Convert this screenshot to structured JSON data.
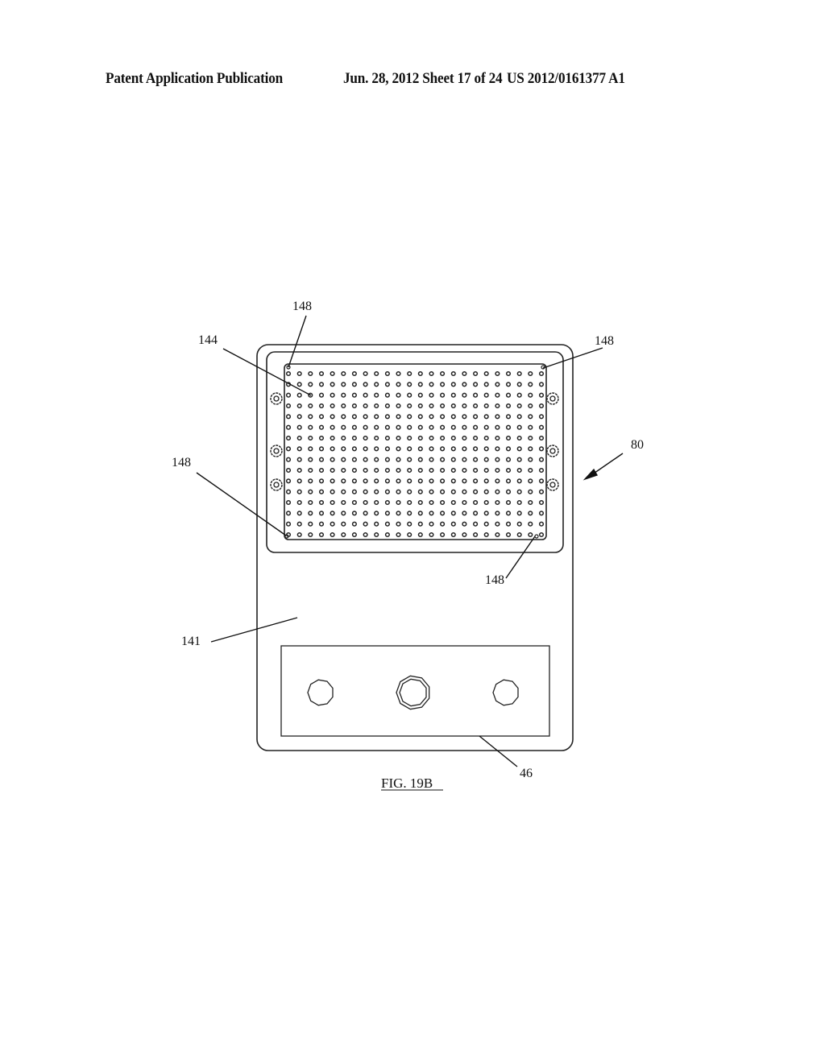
{
  "header": {
    "publication_type": "Patent Application Publication",
    "date_sheet": "Jun. 28, 2012  Sheet 17 of 24",
    "publication_number": "US 2012/0161377 A1"
  },
  "figure": {
    "caption": "FIG. 19B",
    "grid": {
      "columns": 24,
      "rows": 16
    },
    "side_fasteners_per_side": 3,
    "bottom_panel_knobs": 3,
    "reference_labels": {
      "device": "80",
      "dot_array": "144",
      "body_face": "141",
      "bottom_panel": "46",
      "corner_top_left": "148",
      "corner_top_right": "148",
      "corner_bottom_left": "148",
      "corner_bottom_right": "148"
    }
  }
}
